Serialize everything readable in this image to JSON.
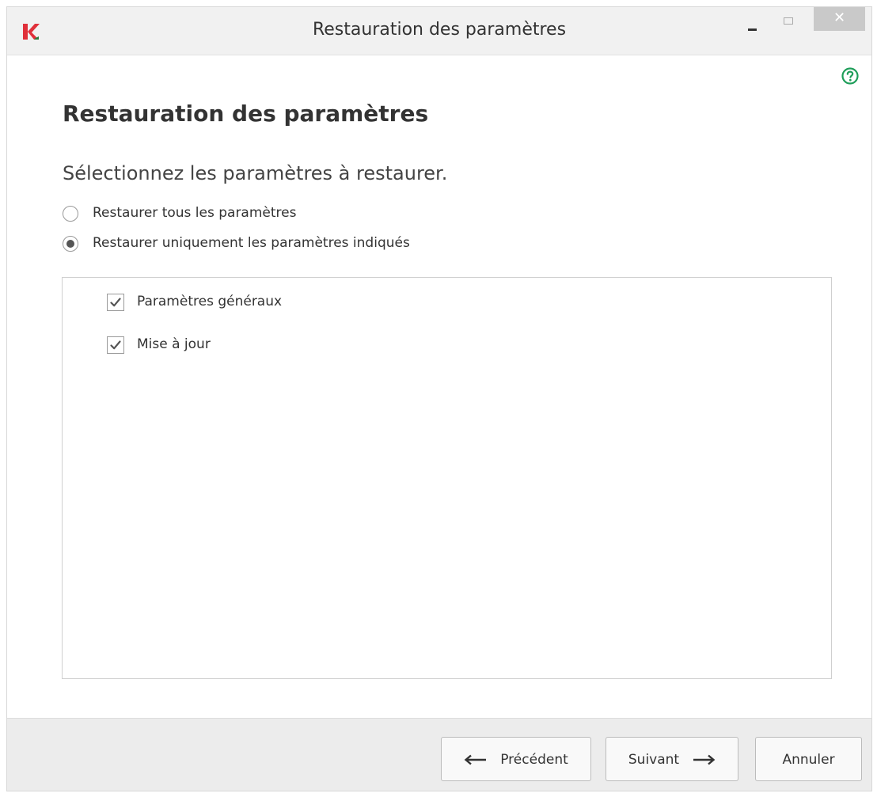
{
  "window": {
    "title": "Restauration des paramètres",
    "close_glyph": "✕",
    "icons": {
      "logo": "kaspersky-logo-icon",
      "minimize": "minimize-icon",
      "maximize": "maximize-icon",
      "close": "close-icon",
      "help": "help-icon"
    }
  },
  "colors": {
    "logo_red": "#e0303a",
    "help_green": "#1f9e5a",
    "close_bg": "#c9c9c9"
  },
  "main": {
    "heading": "Restauration des paramètres",
    "prompt": "Sélectionnez les paramètres à restaurer.",
    "options": [
      {
        "label": "Restaurer tous les paramètres",
        "selected": false
      },
      {
        "label": "Restaurer uniquement les paramètres indiqués",
        "selected": true
      }
    ],
    "settings": [
      {
        "label": "Paramètres généraux",
        "checked": true
      },
      {
        "label": "Mise à jour",
        "checked": true
      }
    ]
  },
  "footer": {
    "prev_label": "Précédent",
    "next_label": "Suivant",
    "cancel_label": "Annuler"
  }
}
